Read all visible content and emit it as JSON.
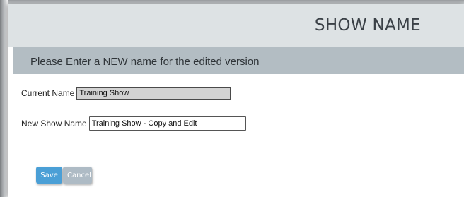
{
  "dialog": {
    "title": "SHOW NAME",
    "prompt": "Please Enter a NEW name for the edited version"
  },
  "form": {
    "current_name_label": "Current Name",
    "current_name_value": "Training Show",
    "new_name_label": "New Show Name",
    "new_name_value": "Training Show - Copy and Edit"
  },
  "buttons": {
    "save_label": "Save",
    "cancel_label": "Cancel"
  },
  "colors": {
    "header_bg": "#dde2e4",
    "subheader_bg": "#b3bdc3",
    "save_button": "#4a9fd6",
    "cancel_button": "#aebbc5",
    "readonly_field_bg": "#d3d3d3"
  }
}
